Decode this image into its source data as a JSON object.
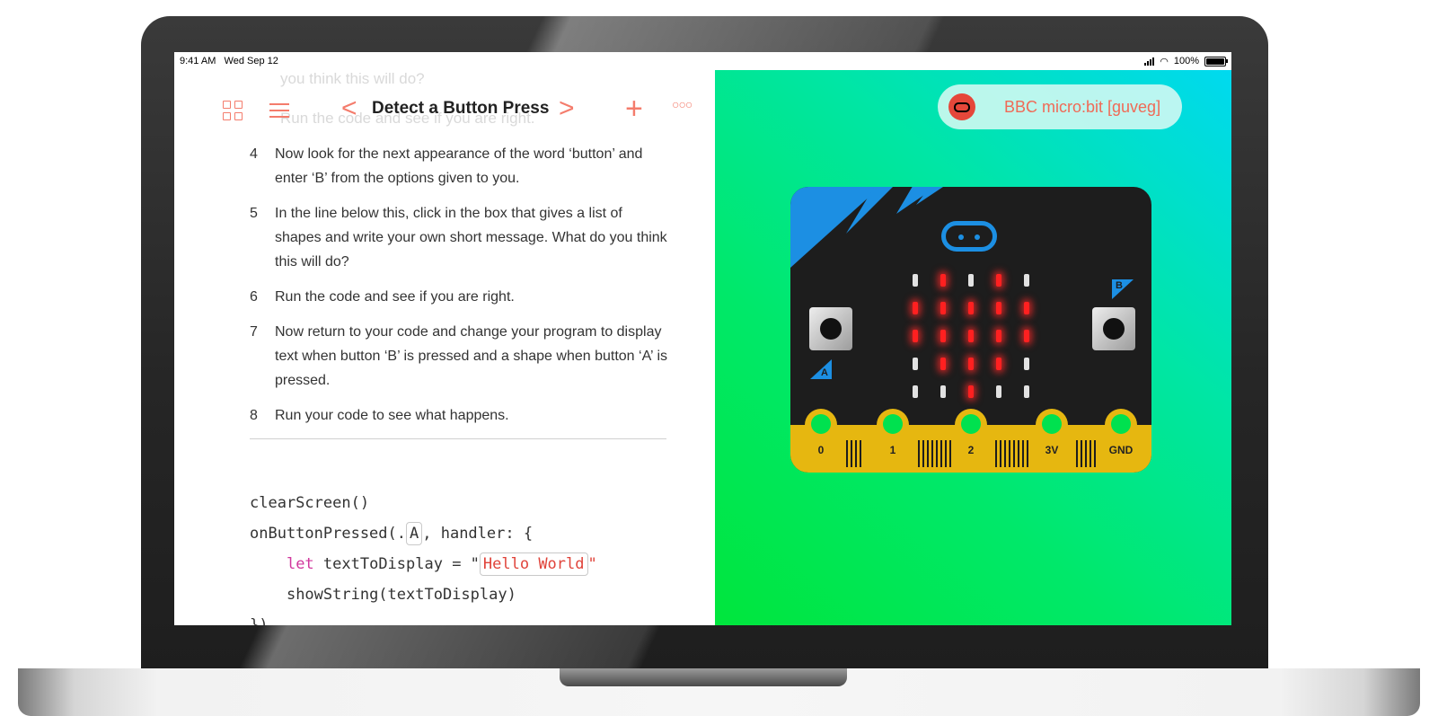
{
  "status_bar": {
    "time": "9:41 AM",
    "date": "Wed Sep 12",
    "battery": "100%"
  },
  "ghost_text": {
    "line1": "you think this will do?",
    "line2": "Run the code and see if you are right."
  },
  "toolbar": {
    "title": "Detect a Button Press"
  },
  "steps": [
    {
      "num": "4",
      "text": "Now look for the next appearance of the word ‘button’ and enter ‘B’ from the options given to you."
    },
    {
      "num": "5",
      "text": "In the line below this, click in the box that gives a list of shapes and write your own short message.  What do you think this will do?"
    },
    {
      "num": "6",
      "text": "Run the code and see if you are right."
    },
    {
      "num": "7",
      "text": "Now return to your code and change your program to display text when button ‘B’ is pressed and a shape when button ‘A’  is pressed."
    },
    {
      "num": "8",
      "text": "Run your code to see what happens."
    }
  ],
  "code": {
    "line1": "clearScreen()",
    "line2_prefix": "onButtonPressed(.",
    "line2_token": "A",
    "line2_suffix": ", handler: {",
    "line3_keyword": "let",
    "line3_mid": " textToDisplay = \"",
    "line3_string": "Hello World",
    "line3_end": "\"",
    "line4": "showString(textToDisplay)",
    "line5": "})"
  },
  "device": {
    "name": "BBC micro:bit [guveg]"
  },
  "board": {
    "button_a_label": "A",
    "button_b_label": "B",
    "pins": [
      "0",
      "1",
      "2",
      "3V",
      "GND"
    ],
    "led_matrix": [
      [
        0,
        1,
        0,
        1,
        0
      ],
      [
        1,
        1,
        1,
        1,
        1
      ],
      [
        1,
        1,
        1,
        1,
        1
      ],
      [
        0,
        1,
        1,
        1,
        0
      ],
      [
        0,
        0,
        1,
        0,
        0
      ]
    ],
    "colors": {
      "led_on": "#ff2020",
      "accent": "#f47c6c",
      "board": "#1d1d1d",
      "edge": "#e6b710",
      "logo": "#1c8fe3"
    }
  }
}
